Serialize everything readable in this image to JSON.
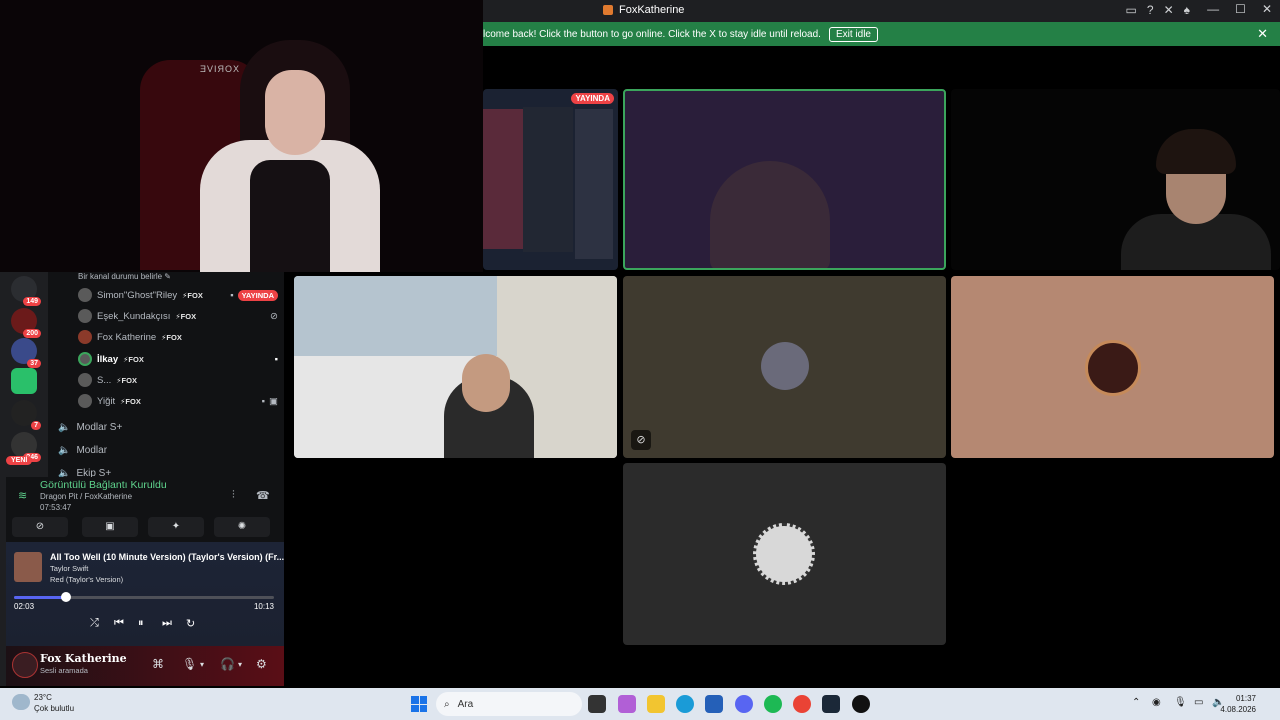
{
  "window": {
    "title": "FoxKatherine",
    "icons": [
      "inbox-icon",
      "help-icon",
      "tools-icon",
      "bug-icon"
    ]
  },
  "notice": {
    "message": "lcome back! Click the button to go online. Click the X to stay idle until reload.",
    "button": "Exit idle",
    "close": "✕"
  },
  "webcam": {
    "logo": "ƎVIЯOX"
  },
  "tiles": {
    "stream_badge": "YAYINDA"
  },
  "channel": {
    "status_prompt": "Bir kanal durumu belirle",
    "members": [
      {
        "name": "Simon\"Ghost\"Riley",
        "tag": "⚡FOX",
        "live": "YAYINDA"
      },
      {
        "name": "Eşek_Kundakçısı",
        "tag": "⚡FOX"
      },
      {
        "name": "Fox Katherine",
        "tag": "⚡FOX"
      },
      {
        "name": "İlkay",
        "tag": "⚡FOX"
      },
      {
        "name": "S...",
        "tag": "⚡FOX"
      },
      {
        "name": "Yiğit",
        "tag": "⚡FOX"
      }
    ],
    "voice_channels": [
      "Modlar S+",
      "Modlar",
      "Ekip S+"
    ]
  },
  "servers": {
    "badges": [
      "149",
      "200",
      "37",
      "7",
      "346"
    ],
    "new_label": "YENİ"
  },
  "voice": {
    "status": "Görüntülü Bağlantı Kuruldu",
    "location": "Dragon Pit / FoxKatherine",
    "elapsed": "07:53:47"
  },
  "music": {
    "song": "All Too Well (10 Minute Version) (Taylor's Version) (Fr...",
    "artist": "Taylor Swift",
    "album": "Red (Taylor's Version)",
    "current_time": "02:03",
    "total_time": "10:13",
    "progress": 0.2
  },
  "user": {
    "name": "Fox Katherine",
    "status": "Sesli aramada"
  },
  "taskbar": {
    "temperature": "23°C",
    "condition": "Çok bulutlu",
    "search_placeholder": "Ara",
    "time": "01:37",
    "date": "4.08.2026"
  }
}
